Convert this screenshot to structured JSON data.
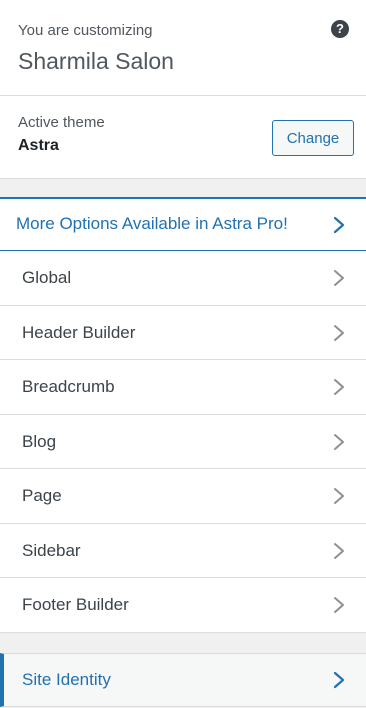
{
  "info": {
    "pre_title": "You are customizing",
    "site_title": "Sharmila Salon",
    "help_icon": "help-icon"
  },
  "theme": {
    "label": "Active theme",
    "name": "Astra",
    "change_label": "Change"
  },
  "pro_link": {
    "label": "More Options Available in Astra Pro!"
  },
  "menu": [
    {
      "label": "Global"
    },
    {
      "label": "Header Builder"
    },
    {
      "label": "Breadcrumb"
    },
    {
      "label": "Blog"
    },
    {
      "label": "Page"
    },
    {
      "label": "Sidebar"
    },
    {
      "label": "Footer Builder"
    }
  ],
  "site_identity": {
    "label": "Site Identity"
  },
  "colors": {
    "accent": "#2271b1",
    "text": "#3c434a",
    "chevron_gray": "#8c8f94",
    "background": "#f0f0f1"
  }
}
